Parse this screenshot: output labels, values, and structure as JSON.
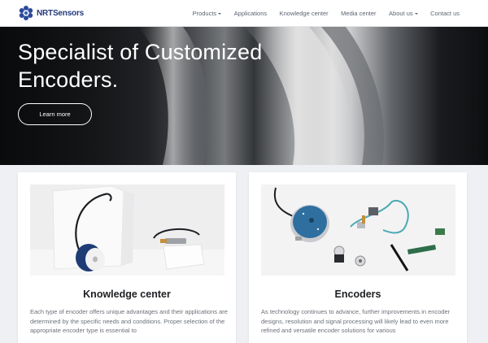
{
  "brand": {
    "name": "NRTSensors",
    "logo_icon": "flower-logo-icon"
  },
  "nav": {
    "items": [
      {
        "label": "Products",
        "dropdown": true
      },
      {
        "label": "Applications",
        "dropdown": false
      },
      {
        "label": "Knowledge center",
        "dropdown": false
      },
      {
        "label": "Media center",
        "dropdown": false
      },
      {
        "label": "About us",
        "dropdown": true
      },
      {
        "label": "Contact us",
        "dropdown": false
      }
    ]
  },
  "hero": {
    "title_line1": "Specialist of Customized",
    "title_line2": "Encoders.",
    "button_label": "Learn more"
  },
  "cards": [
    {
      "title": "Knowledge center",
      "text": "Each type of encoder offers unique advantages and their applications are determined by the specific needs and conditions. Proper selection of the appropriate encoder type is essential to"
    },
    {
      "title": "Encoders",
      "text": "As technology continues to advance, further improvements in encoder designs, resolution and signal processing will likely lead to even more refined and versatile encoder solutions for various"
    }
  ],
  "colors": {
    "brand_blue": "#233a7a",
    "nav_text": "#5b6470",
    "page_bg": "#eef0f3",
    "card_bg": "#ffffff"
  }
}
